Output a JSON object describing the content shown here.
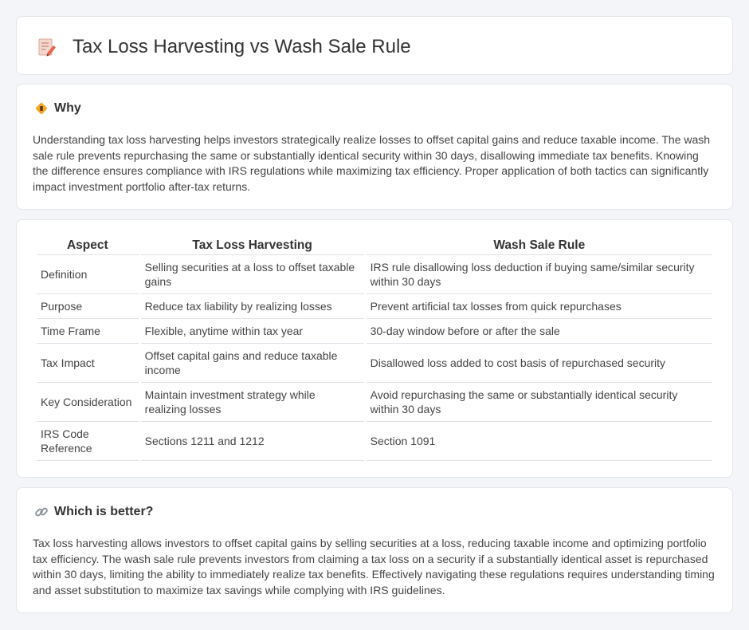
{
  "header": {
    "title": "Tax Loss Harvesting vs Wash Sale Rule",
    "icon": "notepad-pencil-icon"
  },
  "why": {
    "title": "Why",
    "icon": "road-sign-icon",
    "text": "Understanding tax loss harvesting helps investors strategically realize losses to offset capital gains and reduce taxable income. The wash sale rule prevents repurchasing the same or substantially identical security within 30 days, disallowing immediate tax benefits. Knowing the difference ensures compliance with IRS regulations while maximizing tax efficiency. Proper application of both tactics can significantly impact investment portfolio after-tax returns."
  },
  "table": {
    "headers": [
      "Aspect",
      "Tax Loss Harvesting",
      "Wash Sale Rule"
    ],
    "rows": [
      [
        "Definition",
        "Selling securities at a loss to offset taxable gains",
        "IRS rule disallowing loss deduction if buying same/similar security within 30 days"
      ],
      [
        "Purpose",
        "Reduce tax liability by realizing losses",
        "Prevent artificial tax losses from quick repurchases"
      ],
      [
        "Time Frame",
        "Flexible, anytime within tax year",
        "30-day window before or after the sale"
      ],
      [
        "Tax Impact",
        "Offset capital gains and reduce taxable income",
        "Disallowed loss added to cost basis of repurchased security"
      ],
      [
        "Key Consideration",
        "Maintain investment strategy while realizing losses",
        "Avoid repurchasing the same or substantially identical security within 30 days"
      ],
      [
        "IRS Code Reference",
        "Sections 1211 and 1212",
        "Section 1091"
      ]
    ]
  },
  "better": {
    "title": "Which is better?",
    "icon": "link-icon",
    "text": "Tax loss harvesting allows investors to offset capital gains by selling securities at a loss, reducing taxable income and optimizing portfolio tax efficiency. The wash sale rule prevents investors from claiming a tax loss on a security if a substantially identical asset is repurchased within 30 days, limiting the ability to immediately realize tax benefits. Effectively navigating these regulations requires understanding timing and asset substitution to maximize tax savings while complying with IRS guidelines."
  }
}
